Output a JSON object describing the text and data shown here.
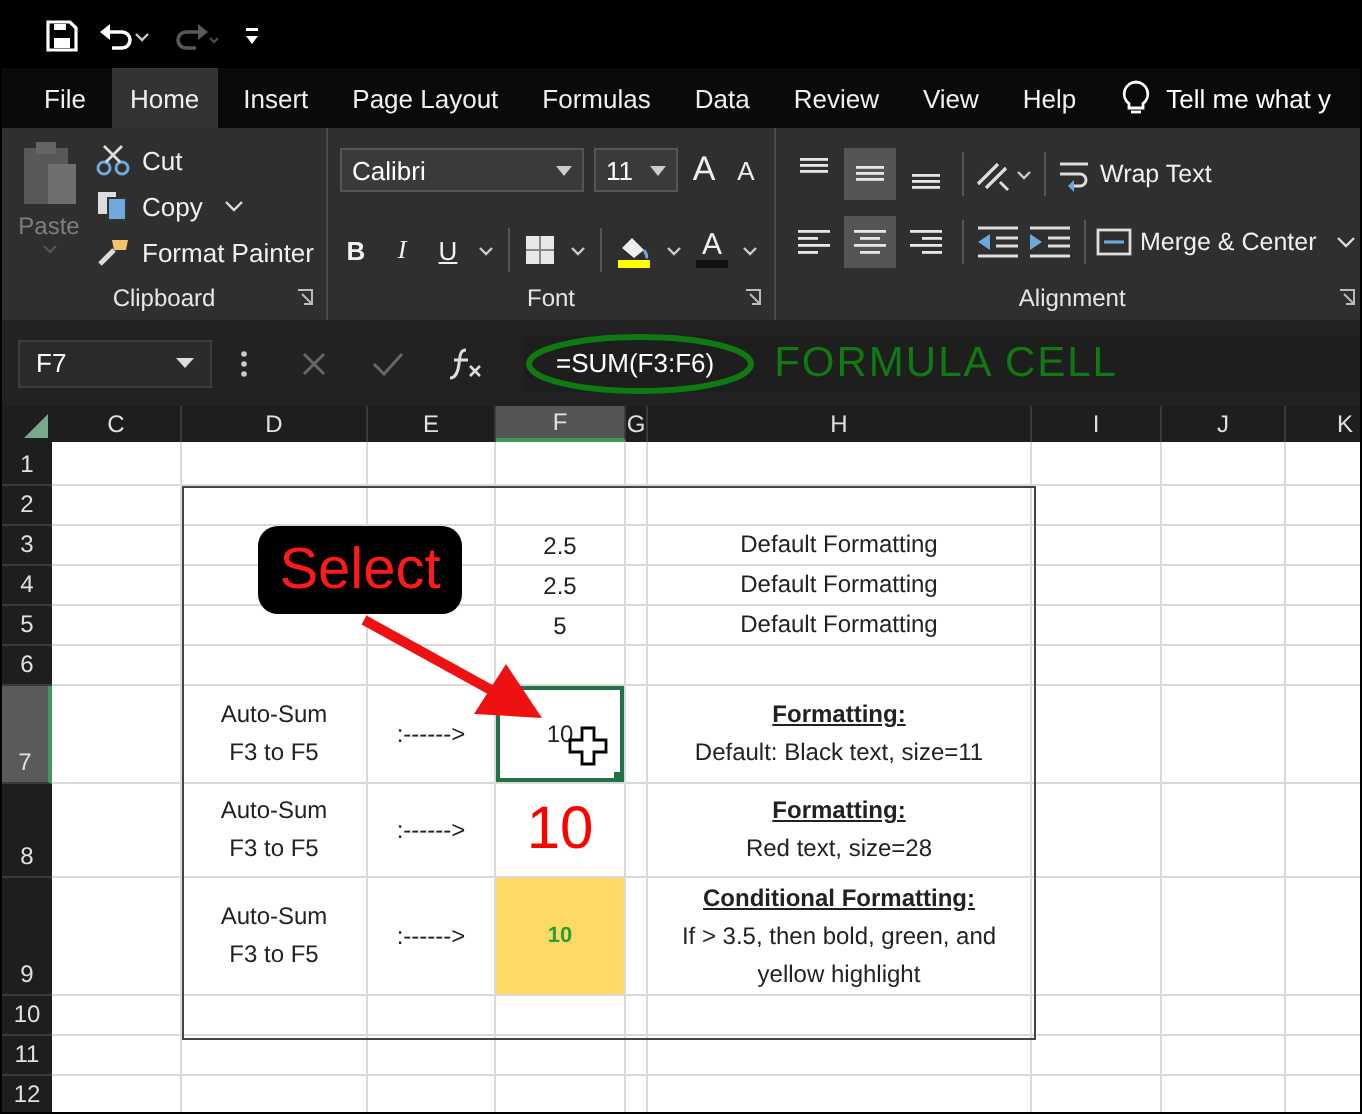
{
  "quick_access": {
    "redo_disabled": true
  },
  "tabs": [
    {
      "label": "File",
      "selected": false
    },
    {
      "label": "Home",
      "selected": true
    },
    {
      "label": "Insert",
      "selected": false
    },
    {
      "label": "Page Layout",
      "selected": false
    },
    {
      "label": "Formulas",
      "selected": false
    },
    {
      "label": "Data",
      "selected": false
    },
    {
      "label": "Review",
      "selected": false
    },
    {
      "label": "View",
      "selected": false
    },
    {
      "label": "Help",
      "selected": false
    }
  ],
  "tell_me": "Tell me what y",
  "ribbon": {
    "clipboard": {
      "title": "Clipboard",
      "paste": {
        "label": "Paste",
        "disabled": true
      },
      "cut": "Cut",
      "copy": "Copy",
      "format_painter": "Format Painter"
    },
    "font": {
      "title": "Font",
      "font_name": "Calibri",
      "font_size": "11",
      "grow_glyph": "A",
      "shrink_glyph": "A",
      "format_buttons": [
        {
          "glyph": "B",
          "kind": "bold"
        },
        {
          "glyph": "I",
          "kind": "italic"
        },
        {
          "glyph": "U",
          "kind": "underline"
        }
      ],
      "color_glyph": "A"
    },
    "alignment": {
      "title": "Alignment",
      "wrap_text": "Wrap Text",
      "merge_center": "Merge & Center",
      "vertical_buttons": [
        {
          "selected": false
        },
        {
          "selected": true
        },
        {
          "selected": false
        }
      ],
      "horizontal_buttons": [
        {
          "selected": false
        },
        {
          "selected": true
        },
        {
          "selected": false
        }
      ]
    }
  },
  "formula_bar": {
    "name_box": "F7",
    "formula": "=SUM(F3:F6)",
    "annotation": "FORMULA CELL"
  },
  "callout": "Select",
  "columns": [
    {
      "label": "C",
      "selected": false
    },
    {
      "label": "D",
      "selected": false
    },
    {
      "label": "E",
      "selected": false
    },
    {
      "label": "F",
      "selected": true
    },
    {
      "label": "G",
      "selected": false
    },
    {
      "label": "H",
      "selected": false
    },
    {
      "label": "I",
      "selected": false
    },
    {
      "label": "J",
      "selected": false
    },
    {
      "label": "K",
      "selected": false
    }
  ],
  "rows": [
    {
      "header": "1",
      "selected": false
    },
    {
      "header": "2",
      "selected": false
    },
    {
      "header": "3",
      "selected": false,
      "value": {
        "text": "2.5",
        "kind": "plain",
        "selected": false
      },
      "note": {
        "text": "Default Formatting"
      }
    },
    {
      "header": "4",
      "selected": false,
      "value": {
        "text": "2.5",
        "kind": "plain",
        "selected": false
      },
      "note": {
        "text": "Default Formatting"
      }
    },
    {
      "header": "5",
      "selected": false,
      "value": {
        "text": "5",
        "kind": "plain",
        "selected": false
      },
      "note": {
        "text": "Default Formatting"
      }
    },
    {
      "header": "6",
      "selected": false
    },
    {
      "header": "7",
      "selected": true,
      "label": "Auto-Sum F3 to F5",
      "arrow": ":------>",
      "value": {
        "text": "10",
        "kind": "plain",
        "selected": true
      },
      "note": {
        "heading": "Formatting:",
        "text": "Default: Black text, size=11"
      }
    },
    {
      "header": "8",
      "selected": false,
      "label": "Auto-Sum F3 to F5",
      "arrow": ":------>",
      "value": {
        "text": "10",
        "kind": "large_red",
        "selected": false
      },
      "note": {
        "heading": "Formatting:",
        "text": "Red text, size=28"
      }
    },
    {
      "header": "9",
      "selected": false,
      "label": "Auto-Sum F3 to F5",
      "arrow": ":------>",
      "value": {
        "text": "10",
        "kind": "highlight",
        "selected": false
      },
      "note": {
        "heading": "Conditional Formatting:",
        "text": "If > 3.5, then bold, green, and yellow highlight"
      }
    },
    {
      "header": "10",
      "selected": false
    },
    {
      "header": "11",
      "selected": false
    },
    {
      "header": "12",
      "selected": false
    }
  ]
}
